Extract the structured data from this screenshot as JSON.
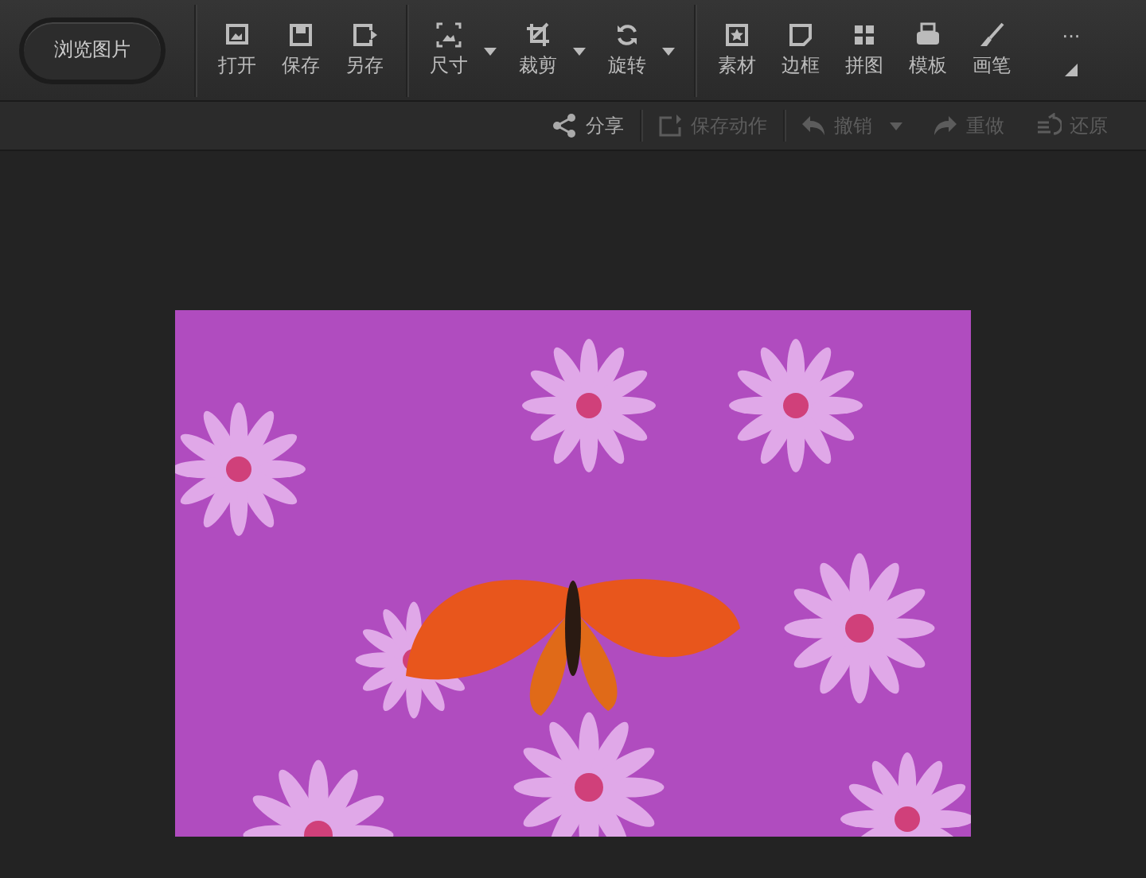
{
  "toolbar": {
    "browse_button": "浏览图片",
    "groups": [
      {
        "items": [
          {
            "label": "打开",
            "dropdown": false
          },
          {
            "label": "保存",
            "dropdown": false
          },
          {
            "label": "另存",
            "dropdown": false
          }
        ]
      },
      {
        "items": [
          {
            "label": "尺寸",
            "dropdown": true
          },
          {
            "label": "裁剪",
            "dropdown": true
          },
          {
            "label": "旋转",
            "dropdown": true
          }
        ]
      },
      {
        "items": [
          {
            "label": "素材",
            "dropdown": false
          },
          {
            "label": "边框",
            "dropdown": false
          },
          {
            "label": "拼图",
            "dropdown": false
          },
          {
            "label": "模板",
            "dropdown": false
          },
          {
            "label": "画笔",
            "dropdown": false
          }
        ]
      }
    ],
    "more": "···"
  },
  "action_bar": {
    "actions": [
      {
        "label": "分享",
        "disabled": false,
        "dropdown": false
      },
      {
        "label": "保存动作",
        "disabled": true,
        "dropdown": false
      },
      {
        "label": "撤销",
        "disabled": true,
        "dropdown": true
      },
      {
        "label": "重做",
        "disabled": true,
        "dropdown": false
      },
      {
        "label": "还原",
        "disabled": true,
        "dropdown": false
      }
    ]
  }
}
